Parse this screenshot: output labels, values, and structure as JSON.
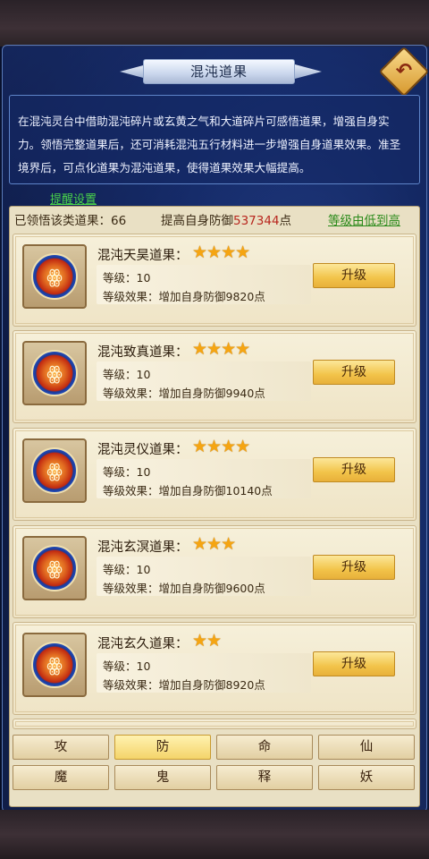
{
  "header": {
    "title": "混沌道果"
  },
  "description": "在混沌灵台中借助混沌碎片或玄黄之气和大道碎片可感悟道果，增强自身实力。领悟完整道果后，还可消耗混沌五行材料进一步增强自身道果效果。准圣境界后，可点化道果为混沌道果，使得道果效果大幅提高。",
  "reminder_label": "提醒设置",
  "stats": {
    "comprehended_label": "已领悟该类道果：",
    "comprehended_count": "66",
    "defense_label": "提高自身防御",
    "defense_value": "537344",
    "defense_unit": "点",
    "sort_label": "等级由低到高"
  },
  "fruits": [
    {
      "name": "混沌天昊道果：",
      "stars": 4,
      "stars_text": "★★★★",
      "level": "等级：10",
      "effect": "等级效果：增加自身防御9820点",
      "button": "升级"
    },
    {
      "name": "混沌致真道果：",
      "stars": 4,
      "stars_text": "★★★★",
      "level": "等级：10",
      "effect": "等级效果：增加自身防御9940点",
      "button": "升级"
    },
    {
      "name": "混沌灵仪道果：",
      "stars": 4,
      "stars_text": "★★★★",
      "level": "等级：10",
      "effect": "等级效果：增加自身防御10140点",
      "button": "升级"
    },
    {
      "name": "混沌玄溟道果：",
      "stars": 3,
      "stars_text": "★★★",
      "level": "等级：10",
      "effect": "等级效果：增加自身防御9600点",
      "button": "升级"
    },
    {
      "name": "混沌玄久道果：",
      "stars": 2,
      "stars_text": "★★",
      "level": "等级：10",
      "effect": "等级效果：增加自身防御8920点",
      "button": "升级"
    }
  ],
  "tabs": [
    {
      "label": "攻",
      "active": false
    },
    {
      "label": "防",
      "active": true
    },
    {
      "label": "命",
      "active": false
    },
    {
      "label": "仙",
      "active": false
    },
    {
      "label": "魔",
      "active": false
    },
    {
      "label": "鬼",
      "active": false
    },
    {
      "label": "释",
      "active": false
    },
    {
      "label": "妖",
      "active": false
    }
  ],
  "colors": {
    "accent_red": "#b8261e",
    "link_green": "#2a8a1a",
    "star": "#f5a512"
  }
}
